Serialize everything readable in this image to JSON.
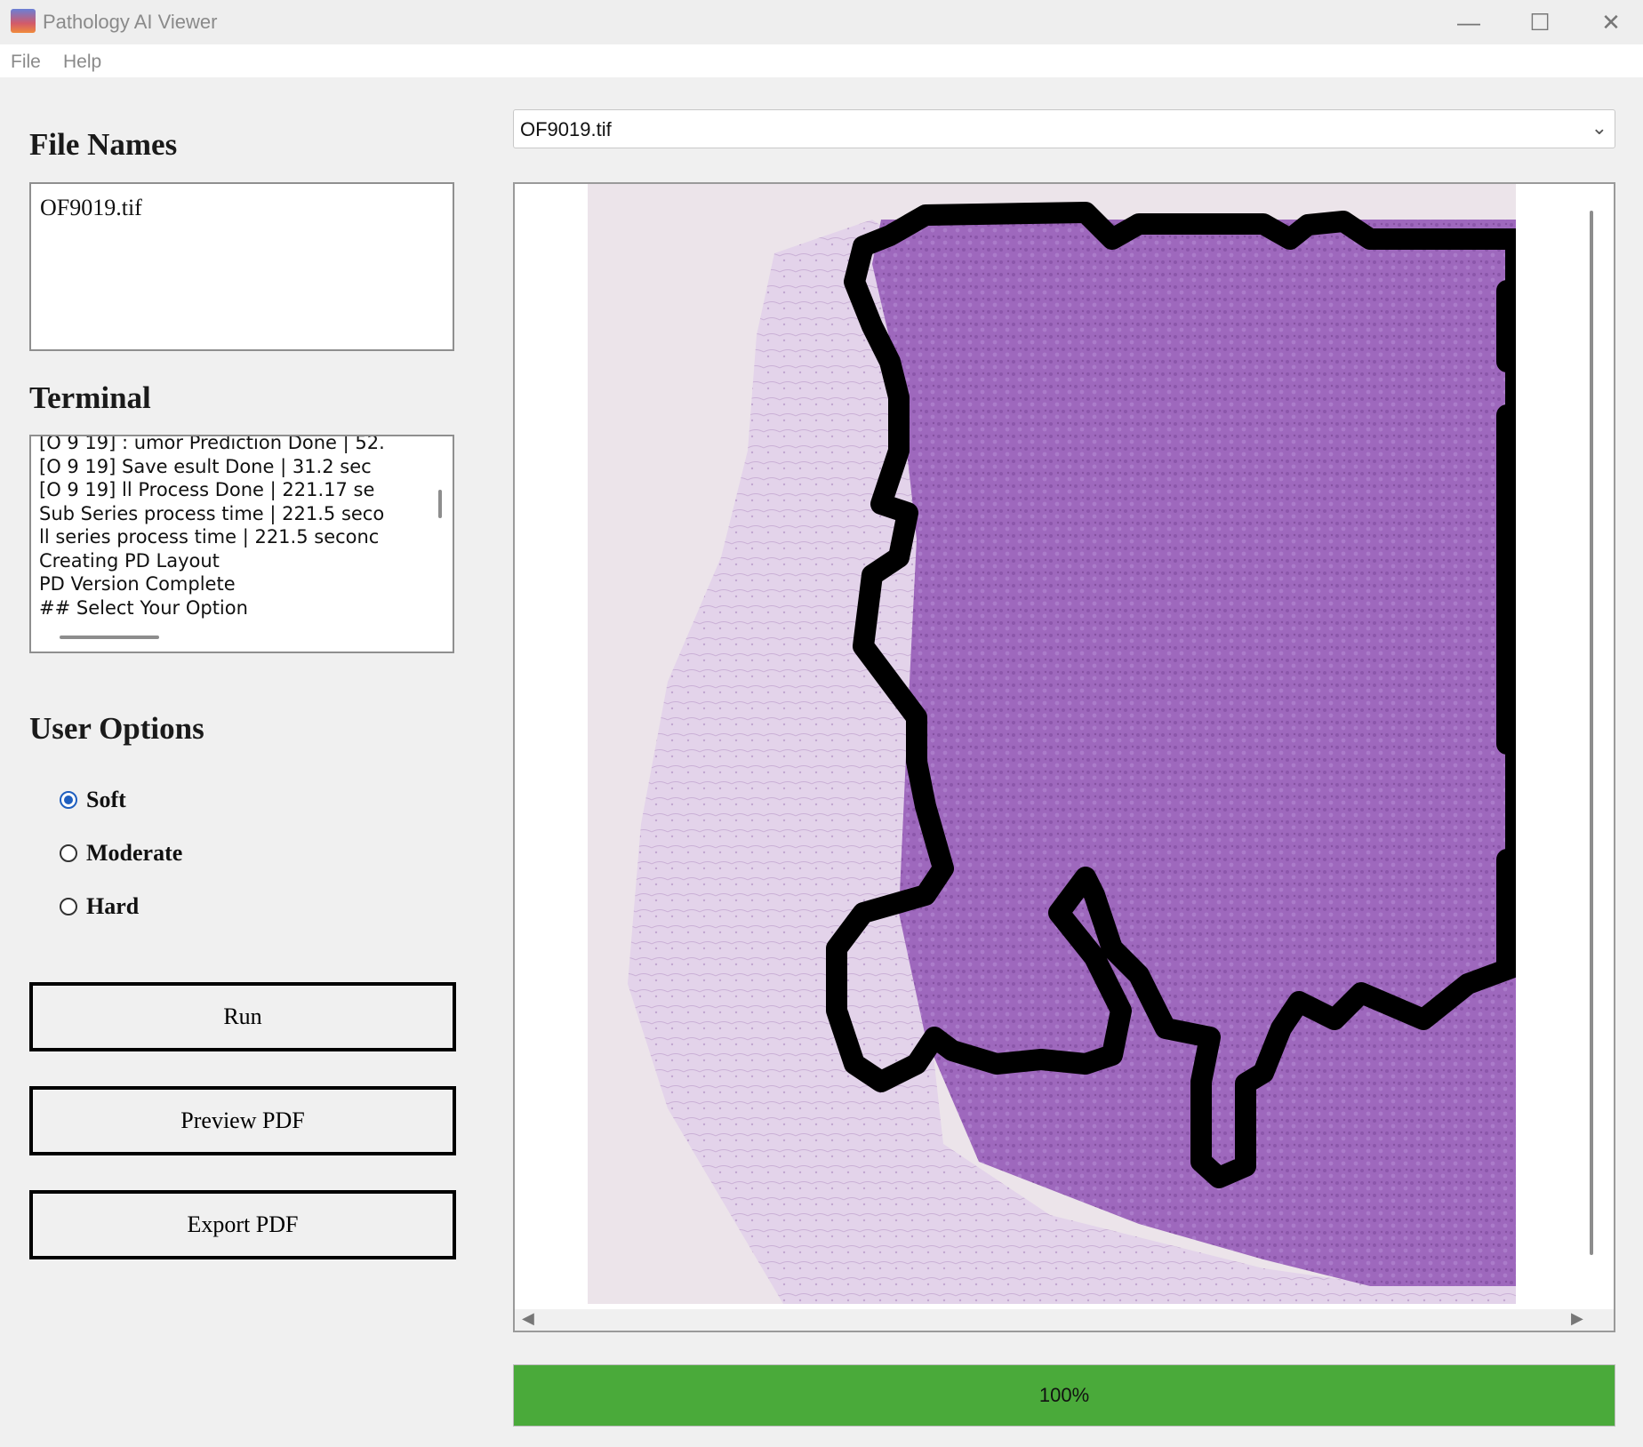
{
  "window": {
    "title": "Pathology AI Viewer",
    "controls": [
      "minimize",
      "maximize",
      "close"
    ]
  },
  "menu": {
    "items": [
      "File",
      "Help"
    ]
  },
  "left_panel": {
    "file_names_title": "File Names",
    "files": [
      "OF9019.tif"
    ],
    "terminal_title": "Terminal",
    "terminal_lines": [
      "[O 9 19] :  umor Prediction Done | 52.",
      "[O 9 19] Save   esult Done | 31.2  sec",
      "[O 9 19]   ll Process Done | 221.17 se",
      "Sub Series process time | 221.5  seco",
      "  ll series process time | 221.5  seconc",
      "Creating PD   Layout",
      "PD   Version Complete",
      "## Select Your Option"
    ],
    "user_options_title": "User Options",
    "options": [
      {
        "label": "Soft",
        "checked": true
      },
      {
        "label": "Moderate",
        "checked": false
      },
      {
        "label": "Hard",
        "checked": false
      }
    ],
    "buttons": {
      "run": "Run",
      "preview": "Preview PDF",
      "export": "Export PDF"
    }
  },
  "viewer": {
    "selected_file": "OF9019.tif",
    "tissue_color": "#a06cc0",
    "outline_color": "#000000"
  },
  "progress": {
    "value": 1.0,
    "label": "100%",
    "color": "#4aaa3a"
  }
}
